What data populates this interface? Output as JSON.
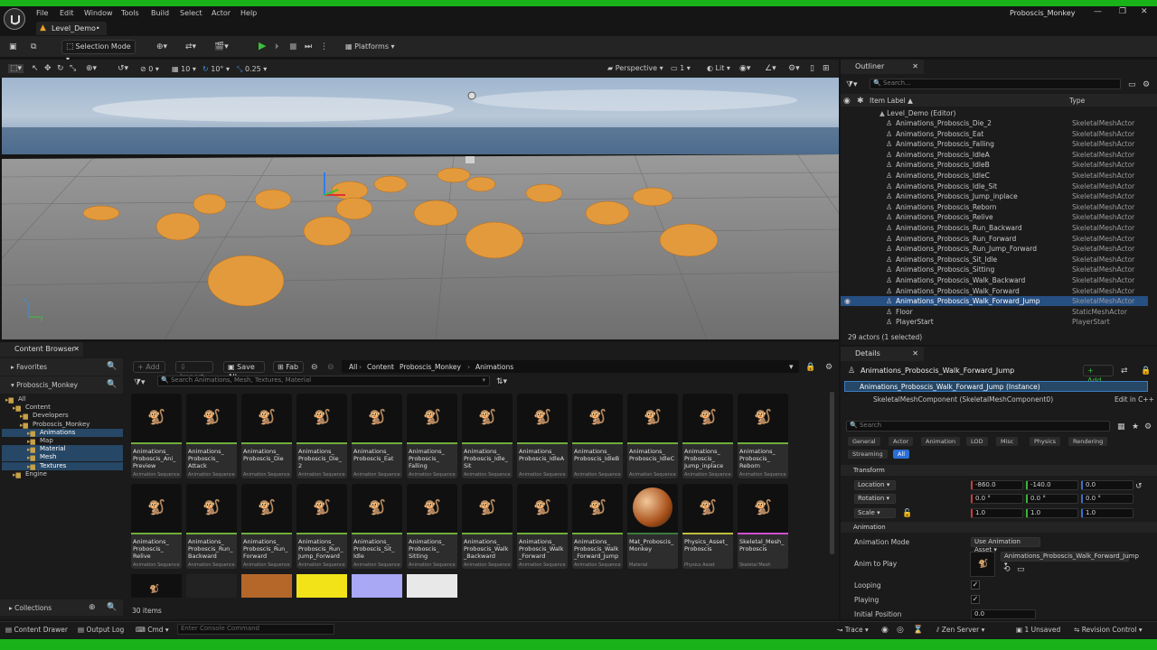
{
  "menu": [
    "File",
    "Edit",
    "Window",
    "Tools",
    "Build",
    "Select",
    "Actor",
    "Help"
  ],
  "window_title": "Proboscis_Monkey",
  "level_tab": "Level_Demo•",
  "toolbar": {
    "selection_mode": "Selection Mode",
    "platforms": "Platforms"
  },
  "viewport_bar": {
    "grid_snap": "0",
    "grid_size": "10",
    "rot_snap": "10°",
    "scale_snap": "0.25",
    "view_mode_perspective": "Perspective",
    "camera_speed": "1",
    "lighting": "Lit"
  },
  "outliner": {
    "title": "Outliner",
    "search_placeholder": "Search...",
    "col_label": "Item Label ▲",
    "col_type": "Type",
    "root": "Level_Demo (Editor)",
    "rows": [
      {
        "label": "Animations_Proboscis_Die_2",
        "type": "SkeletalMeshActor"
      },
      {
        "label": "Animations_Proboscis_Eat",
        "type": "SkeletalMeshActor"
      },
      {
        "label": "Animations_Proboscis_Falling",
        "type": "SkeletalMeshActor"
      },
      {
        "label": "Animations_Proboscis_IdleA",
        "type": "SkeletalMeshActor"
      },
      {
        "label": "Animations_Proboscis_IdleB",
        "type": "SkeletalMeshActor"
      },
      {
        "label": "Animations_Proboscis_IdleC",
        "type": "SkeletalMeshActor"
      },
      {
        "label": "Animations_Proboscis_Idle_Sit",
        "type": "SkeletalMeshActor"
      },
      {
        "label": "Animations_Proboscis_Jump_inplace",
        "type": "SkeletalMeshActor"
      },
      {
        "label": "Animations_Proboscis_Reborn",
        "type": "SkeletalMeshActor"
      },
      {
        "label": "Animations_Proboscis_Relive",
        "type": "SkeletalMeshActor"
      },
      {
        "label": "Animations_Proboscis_Run_Backward",
        "type": "SkeletalMeshActor"
      },
      {
        "label": "Animations_Proboscis_Run_Forward",
        "type": "SkeletalMeshActor"
      },
      {
        "label": "Animations_Proboscis_Run_Jump_Forward",
        "type": "SkeletalMeshActor"
      },
      {
        "label": "Animations_Proboscis_Sit_Idle",
        "type": "SkeletalMeshActor"
      },
      {
        "label": "Animations_Proboscis_Sitting",
        "type": "SkeletalMeshActor"
      },
      {
        "label": "Animations_Proboscis_Walk_Backward",
        "type": "SkeletalMeshActor"
      },
      {
        "label": "Animations_Proboscis_Walk_Forward",
        "type": "SkeletalMeshActor"
      },
      {
        "label": "Animations_Proboscis_Walk_Forward_Jump",
        "type": "SkeletalMeshActor"
      },
      {
        "label": "Floor",
        "type": "StaticMeshActor"
      },
      {
        "label": "PlayerStart",
        "type": "PlayerStart"
      }
    ],
    "footer": "29 actors (1 selected)"
  },
  "details": {
    "title": "Details",
    "actor_name": "Animations_Proboscis_Walk_Forward_Jump",
    "add_label": "+ Add",
    "instance": "Animations_Proboscis_Walk_Forward_Jump (Instance)",
    "component": "SkeletalMeshComponent (SkeletalMeshComponent0)",
    "edit_cpp": "Edit in C++",
    "search_placeholder": "Search",
    "categories": [
      "General",
      "Actor",
      "Animation",
      "LOD",
      "Misc",
      "Physics",
      "Rendering",
      "Streaming",
      "All"
    ],
    "transform_title": "Transform",
    "location_label": "Location",
    "rotation_label": "Rotation",
    "scale_label": "Scale",
    "location": [
      "-860.0",
      "-140.0",
      "0.0"
    ],
    "rotation": [
      "0.0 °",
      "0.0 °",
      "0.0 °"
    ],
    "scale": [
      "1.0",
      "1.0",
      "1.0"
    ],
    "animation_title": "Animation",
    "anim_mode_label": "Animation Mode",
    "anim_mode_value": "Use Animation Asset",
    "anim_to_play_label": "Anim to Play",
    "anim_to_play_value": "Animations_Proboscis_Walk_Forward_Jump",
    "looping_label": "Looping",
    "playing_label": "Playing",
    "initial_position_label": "Initial Position",
    "initial_position_value": "0.0"
  },
  "content_browser": {
    "title": "Content Browser",
    "add": "+ Add",
    "import": "Import",
    "save_all": "Save All",
    "fab": "Fab",
    "breadcrumb": [
      "All",
      "Content",
      "Proboscis_Monkey",
      "Animations"
    ],
    "search_placeholder": "Search Animations, Mesh, Textures, Material",
    "favorites": "Favorites",
    "project": "Proboscis_Monkey",
    "tree": [
      {
        "label": "All",
        "depth": 0
      },
      {
        "label": "Content",
        "depth": 1
      },
      {
        "label": "Developers",
        "depth": 2
      },
      {
        "label": "Proboscis_Monkey",
        "depth": 2
      },
      {
        "label": "Animations",
        "depth": 3
      },
      {
        "label": "Map",
        "depth": 3
      },
      {
        "label": "Material",
        "depth": 3
      },
      {
        "label": "Mesh",
        "depth": 3
      },
      {
        "label": "Textures",
        "depth": 3
      },
      {
        "label": "Engine",
        "depth": 1
      }
    ],
    "collections": "Collections",
    "items_count": "30 items",
    "assets": [
      {
        "name": "Animations_\nProboscis_Ani_\nPreview",
        "type": "Animation Sequence"
      },
      {
        "name": "Animations_\nProboscis_\nAttack",
        "type": "Animation Sequence"
      },
      {
        "name": "Animations_\nProboscis_Die",
        "type": "Animation Sequence"
      },
      {
        "name": "Animations_\nProboscis_Die_\n2",
        "type": "Animation Sequence"
      },
      {
        "name": "Animations_\nProboscis_Eat",
        "type": "Animation Sequence"
      },
      {
        "name": "Animations_\nProboscis_\nFalling",
        "type": "Animation Sequence"
      },
      {
        "name": "Animations_\nProboscis_Idle_\nSit",
        "type": "Animation Sequence"
      },
      {
        "name": "Animations_\nProboscis_IdleA",
        "type": "Animation Sequence"
      },
      {
        "name": "Animations_\nProboscis_IdleB",
        "type": "Animation Sequence"
      },
      {
        "name": "Animations_\nProboscis_IdleC",
        "type": "Animation Sequence"
      },
      {
        "name": "Animations_\nProboscis_\nJump_inplace",
        "type": "Animation Sequence"
      },
      {
        "name": "Animations_\nProboscis_\nReborn",
        "type": "Animation Sequence"
      },
      {
        "name": "Animations_\nProboscis_\nRelive",
        "type": "Animation Sequence"
      },
      {
        "name": "Animations_\nProboscis_Run_\nBackward",
        "type": "Animation Sequence"
      },
      {
        "name": "Animations_\nProboscis_Run_\nForward",
        "type": "Animation Sequence"
      },
      {
        "name": "Animations_\nProboscis_Run_\nJump_Forward",
        "type": "Animation Sequence"
      },
      {
        "name": "Animations_\nProboscis_Sit_\nIdle",
        "type": "Animation Sequence"
      },
      {
        "name": "Animations_\nProboscis_\nSitting",
        "type": "Animation Sequence"
      },
      {
        "name": "Animations_\nProboscis_Walk\n_Backward",
        "type": "Animation Sequence"
      },
      {
        "name": "Animations_\nProboscis_Walk\n_Forward",
        "type": "Animation Sequence"
      },
      {
        "name": "Animations_\nProboscis_Walk\n_Forward_Jump",
        "type": "Animation Sequence"
      },
      {
        "name": "Mat_Proboscis_\nMonkey",
        "type": "Material"
      },
      {
        "name": "Physics_Asset_\nProboscis",
        "type": "Physics Asset"
      },
      {
        "name": "Skeletal_Mesh_\nProboscis",
        "type": "Skeletal Mesh"
      }
    ]
  },
  "statusbar": {
    "content_drawer": "Content Drawer",
    "output_log": "Output Log",
    "cmd": "Cmd",
    "console_placeholder": "Enter Console Command",
    "trace": "Trace",
    "zen_server": "Zen Server",
    "unsaved": "1 Unsaved",
    "revision_control": "Revision Control"
  },
  "colors": {
    "accent_green": "#19b319",
    "selection_blue": "#1f5fa8",
    "tree_select": "#264766"
  }
}
